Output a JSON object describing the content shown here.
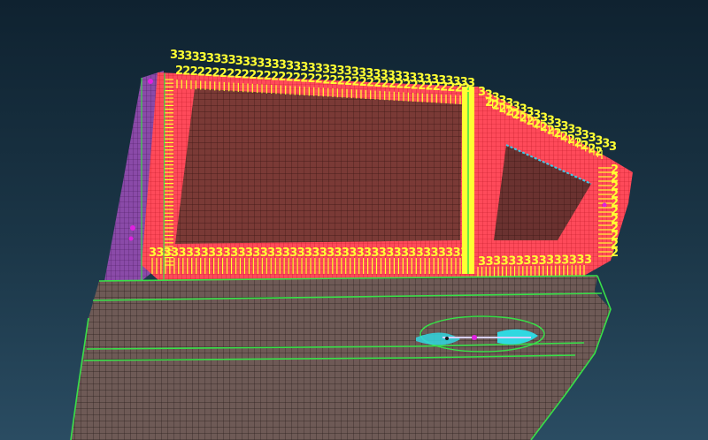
{
  "colors": {
    "bg_top": "#0f2230",
    "bg_bottom": "#2a4c62",
    "door_skin": "#6e5a56",
    "glass_mesh": "#7a3a36",
    "seal_flange": "#ff4a5a",
    "edge_green": "#38e048",
    "label_yellow": "#ffff33",
    "spring_cyan": "#40c8e8",
    "handle_cyan": "#30d8e0",
    "magenta_marker": "#e020e0",
    "pillar_purple": "#8a4aa8",
    "rivet_black": "#141414"
  },
  "labels": {
    "top_row_char": "3",
    "inner_row_char": "2",
    "bottom_row_char": "3"
  }
}
